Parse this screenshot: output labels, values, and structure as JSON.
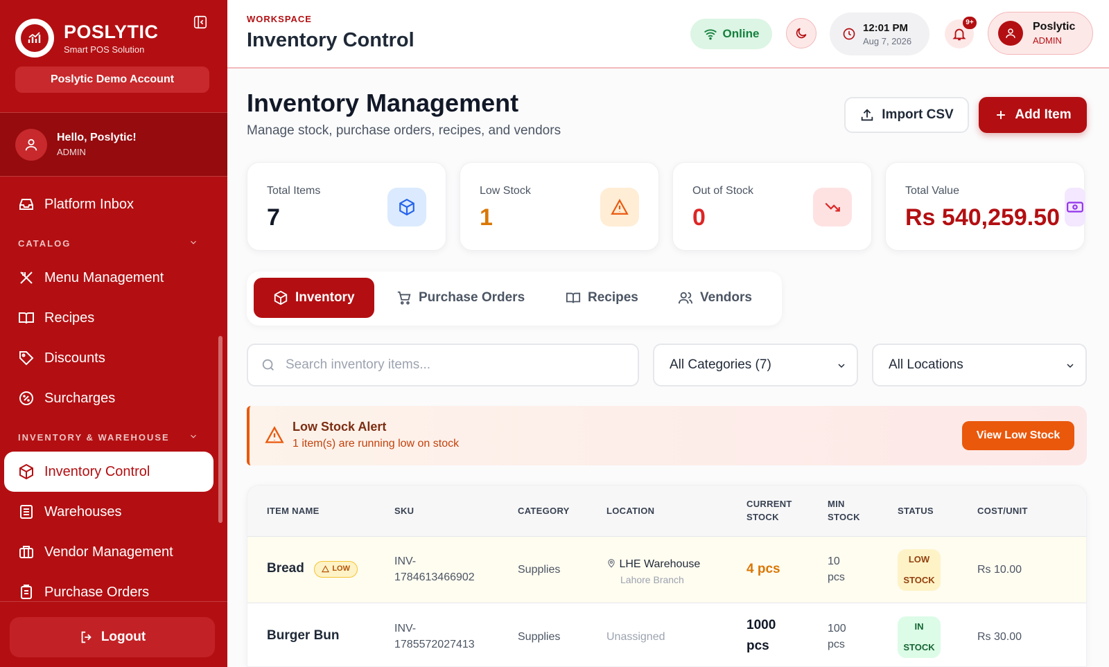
{
  "sidebar": {
    "brand_name": "POSLYTIC",
    "brand_tagline": "Smart POS Solution",
    "account": "Poslytic Demo Account",
    "user_greeting": "Hello, Poslytic!",
    "user_role": "ADMIN",
    "inbox": "Platform Inbox",
    "section_catalog": "CATALOG",
    "section_inventory": "INVENTORY & WAREHOUSE",
    "items": {
      "menu": "Menu Management",
      "recipes": "Recipes",
      "discounts": "Discounts",
      "surcharges": "Surcharges",
      "inventory_control": "Inventory Control",
      "warehouses": "Warehouses",
      "vendor_management": "Vendor Management",
      "purchase_orders": "Purchase Orders"
    },
    "logout": "Logout"
  },
  "header": {
    "workspace_label": "WORKSPACE",
    "title": "Inventory Control",
    "status": "Online",
    "time": "12:01 PM",
    "date": "Aug 7, 2026",
    "notif_badge": "9+",
    "profile_name": "Poslytic",
    "profile_role": "ADMIN"
  },
  "page": {
    "title": "Inventory Management",
    "subtitle": "Manage stock, purchase orders, recipes, and vendors",
    "import_label": "Import CSV",
    "add_label": "Add Item"
  },
  "stats": {
    "total_items_label": "Total Items",
    "total_items": "7",
    "low_stock_label": "Low Stock",
    "low_stock": "1",
    "out_stock_label": "Out of Stock",
    "out_stock": "0",
    "total_value_label": "Total Value",
    "total_value": "Rs 540,259.50"
  },
  "tabs": {
    "inventory": "Inventory",
    "purchase_orders": "Purchase Orders",
    "recipes": "Recipes",
    "vendors": "Vendors"
  },
  "filters": {
    "search_placeholder": "Search inventory items...",
    "category": "All Categories (7)",
    "location": "All Locations"
  },
  "alert": {
    "title": "Low Stock Alert",
    "text": "1 item(s) are running low on stock",
    "button": "View Low Stock"
  },
  "table": {
    "headers": {
      "item_name": "ITEM NAME",
      "sku": "SKU",
      "category": "CATEGORY",
      "location": "LOCATION",
      "current_stock_1": "CURRENT",
      "current_stock_2": "STOCK",
      "min_stock_1": "MIN",
      "min_stock_2": "STOCK",
      "status": "STATUS",
      "cost_unit": "COST/UNIT"
    },
    "rows": [
      {
        "name": "Bread",
        "tag": "LOW",
        "sku_1": "INV-",
        "sku_2": "1784613466902",
        "category": "Supplies",
        "location": "LHE Warehouse",
        "branch": "Lahore Branch",
        "stock": "4 pcs",
        "min_1": "10",
        "min_2": "pcs",
        "status_1": "LOW",
        "status_2": "STOCK",
        "cost": "Rs 10.00"
      },
      {
        "name": "Burger Bun",
        "sku_1": "INV-",
        "sku_2": "1785572027413",
        "category": "Supplies",
        "location": "Unassigned",
        "stock_1": "1000",
        "stock_2": "pcs",
        "min_1": "100",
        "min_2": "pcs",
        "status_1": "IN",
        "status_2": "STOCK",
        "cost": "Rs 30.00"
      }
    ]
  },
  "colors": {
    "brand": "#b30f12",
    "warning": "#ea580c",
    "success": "#15803d"
  }
}
